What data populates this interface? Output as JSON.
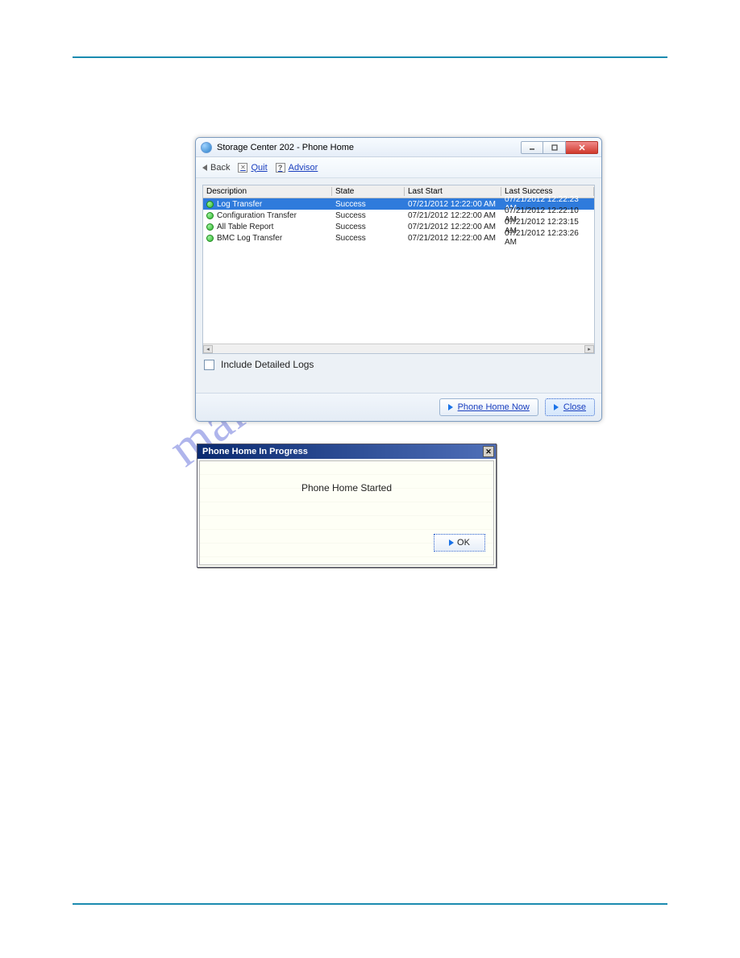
{
  "watermark": "manualshive.com",
  "dialog": {
    "title": "Storage Center 202 - Phone Home",
    "toolbar": {
      "back": "Back",
      "quit": "Quit",
      "advisor": "Advisor"
    },
    "columns": {
      "desc": "Description",
      "state": "State",
      "start": "Last Start",
      "succ": "Last Success"
    },
    "rows": [
      {
        "desc": "Log Transfer",
        "state": "Success",
        "start": "07/21/2012 12:22:00 AM",
        "succ": "07/21/2012 12:22:23 AM",
        "selected": true
      },
      {
        "desc": "Configuration Transfer",
        "state": "Success",
        "start": "07/21/2012 12:22:00 AM",
        "succ": "07/21/2012 12:22:10 AM",
        "selected": false
      },
      {
        "desc": "All Table Report",
        "state": "Success",
        "start": "07/21/2012 12:22:00 AM",
        "succ": "07/21/2012 12:23:15 AM",
        "selected": false
      },
      {
        "desc": "BMC Log Transfer",
        "state": "Success",
        "start": "07/21/2012 12:22:00 AM",
        "succ": "07/21/2012 12:23:26 AM",
        "selected": false
      }
    ],
    "checkbox": "Include Detailed Logs",
    "btn_phone": "Phone Home Now",
    "btn_close": "Close"
  },
  "modal": {
    "title": "Phone Home In Progress",
    "msg": "Phone Home Started",
    "ok": "OK"
  }
}
